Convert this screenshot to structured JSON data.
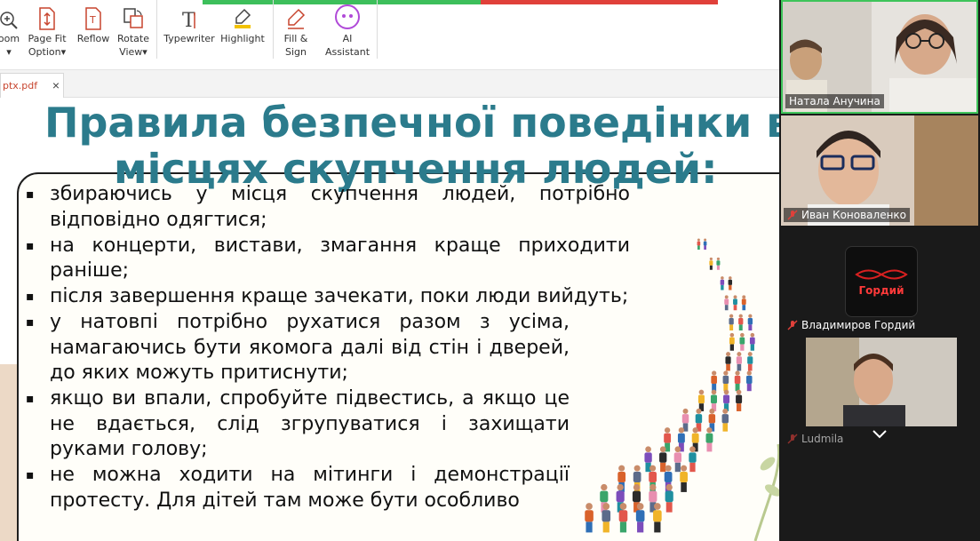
{
  "toolbar": {
    "items": [
      {
        "label": "oom",
        "has_caret": true
      },
      {
        "label": "Page Fit\nOption",
        "has_caret": true
      },
      {
        "label": "Reflow",
        "has_caret": false
      },
      {
        "label": "Rotate\nView",
        "has_caret": true
      },
      {
        "label": "Typewriter",
        "has_caret": false
      },
      {
        "label": "Highlight",
        "has_caret": false
      },
      {
        "label": "Fill &\nSign",
        "has_caret": false
      },
      {
        "label": "AI\nAssistant",
        "has_caret": false
      }
    ],
    "caret": "▾"
  },
  "tabs": {
    "doc_name": "ptx.pdf",
    "close": "×"
  },
  "slide": {
    "title_line1": "Правила безпечної поведінки в",
    "title_line2": "місцях скупчення людей:",
    "bullet_marker": "▪",
    "bullets": [
      "збираючись у місця скупчення людей, потрібно відповідно одягтися;",
      "на концерти, вистави, змагання краще приходити раніше;",
      "після завершення краще зачекати, поки люди вийдуть;",
      "у натовпі потрібно рухатися разом з усіма, намагаючись бути якомога далі від стін і дверей, до яких можуть притиснути;",
      "якщо ви впали, спробуйте підвестись, а якщо це не вдається, слід згрупуватися і захищати руками голову;",
      "не можна ходити на мітинги і демонстрації протесту. Для дітей там може бути особливо"
    ]
  },
  "participants": [
    {
      "name": "Натала Анучина",
      "muted": false,
      "active_speaker": true
    },
    {
      "name": "Иван Коноваленко",
      "muted": true,
      "active_speaker": false
    },
    {
      "name": "Владимиров Гордий",
      "muted": true,
      "active_speaker": false,
      "avatar_text": "Гордий"
    },
    {
      "name": "Ludmila",
      "muted": true,
      "active_speaker": false
    }
  ],
  "colors": {
    "title": "#2b7b8c",
    "active_border": "#3ec45a",
    "muted_icon": "#e0403a",
    "tab_text": "#c7442d"
  }
}
